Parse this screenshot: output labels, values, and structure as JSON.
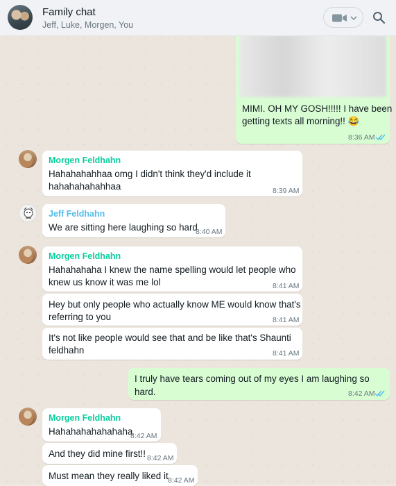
{
  "header": {
    "title": "Family chat",
    "participants": "Jeff, Luke, Morgen, You"
  },
  "colors": {
    "sender_morgen": "#06cf9c",
    "sender_jeff": "#53bdeb",
    "outgoing_bubble": "#d9fdd3",
    "read_ticks": "#53bdeb"
  },
  "messages": [
    {
      "dir": "out",
      "text_lines": [
        "MIMI. OH MY GOSH!!!!! I have been",
        "getting texts all morning!! 😂"
      ],
      "time": "8:36 AM",
      "read": true
    },
    {
      "dir": "in",
      "sender": "Morgen Feldhahn",
      "text_lines": [
        "Hahahahahhaa omg I didn't think they'd include it",
        "hahahahahahhaa"
      ],
      "time": "8:39 AM"
    },
    {
      "dir": "in",
      "sender": "Jeff Feldhahn",
      "text_lines": [
        "We are sitting here laughing so hard"
      ],
      "time": "8:40 AM"
    },
    {
      "dir": "in",
      "sender": "Morgen Feldhahn",
      "text_lines": [
        "Hahahahaha I knew the name spelling would let people who",
        "knew us know it was me lol"
      ],
      "time": "8:41 AM"
    },
    {
      "dir": "in",
      "text_lines": [
        "Hey but only people who actually know ME would know that's",
        "referring to you"
      ],
      "time": "8:41 AM"
    },
    {
      "dir": "in",
      "text_lines": [
        "It's not like people would see that and be like that's Shaunti",
        "feldhahn"
      ],
      "time": "8:41 AM"
    },
    {
      "dir": "out",
      "text_lines": [
        "I truly have tears coming out of my eyes I am laughing so hard."
      ],
      "time": "8:42 AM",
      "read": true
    },
    {
      "dir": "in",
      "sender": "Morgen Feldhahn",
      "text_lines": [
        "Hahahahahahahaha"
      ],
      "time": "8:42 AM"
    },
    {
      "dir": "in",
      "text_lines": [
        "And they did mine first!!"
      ],
      "time": "8:42 AM"
    },
    {
      "dir": "in",
      "text_lines": [
        "Must mean they really liked it"
      ],
      "time": "8:42 AM"
    }
  ]
}
